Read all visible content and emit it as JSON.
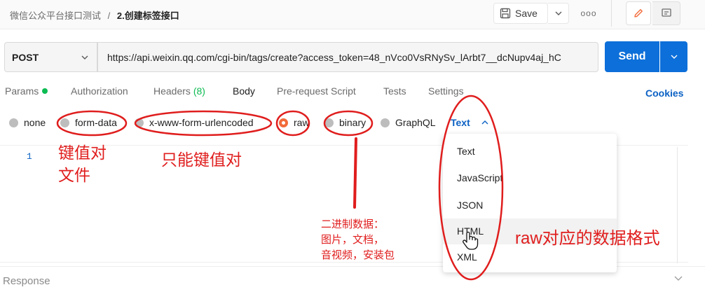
{
  "header": {
    "breadcrumb_parent": "微信公众平台接口测试",
    "breadcrumb_separator": "/",
    "breadcrumb_current": "2.创建标签接口",
    "save_label": "Save",
    "more_label": "ooo"
  },
  "request": {
    "method": "POST",
    "url": "https://api.weixin.qq.com/cgi-bin/tags/create?access_token=48_nVco0VsRNySv_lArbt7__dcNupv4aj_hC",
    "send_label": "Send"
  },
  "tabs": {
    "params": "Params",
    "authorization": "Authorization",
    "headers": "Headers",
    "headers_count": "(8)",
    "body": "Body",
    "prerequest": "Pre-request Script",
    "tests": "Tests",
    "settings": "Settings",
    "cookies": "Cookies"
  },
  "body_types": {
    "none": "none",
    "form_data": "form-data",
    "urlencoded": "x-www-form-urlencoded",
    "raw": "raw",
    "binary": "binary",
    "graphql": "GraphQL",
    "selected_format": "Text"
  },
  "editor": {
    "line_number": "1"
  },
  "dropdown": {
    "items": [
      "Text",
      "JavaScript",
      "JSON",
      "HTML",
      "XML"
    ]
  },
  "response": {
    "label": "Response"
  },
  "annotations": {
    "form_data_note_line1": "键值对",
    "form_data_note_line2": "文件",
    "urlencoded_note": "只能键值对",
    "binary_note_line1": "二进制数据：",
    "binary_note_line2": "图片，文档，",
    "binary_note_line3": "音视频，安装包",
    "raw_note": "raw对应的数据格式"
  },
  "colors": {
    "send_blue": "#0d6fd9",
    "link_blue": "#0b61c4",
    "active_green": "#0cbb52",
    "radio_orange": "#f26b3a",
    "annotation_red": "#e01d1d"
  }
}
